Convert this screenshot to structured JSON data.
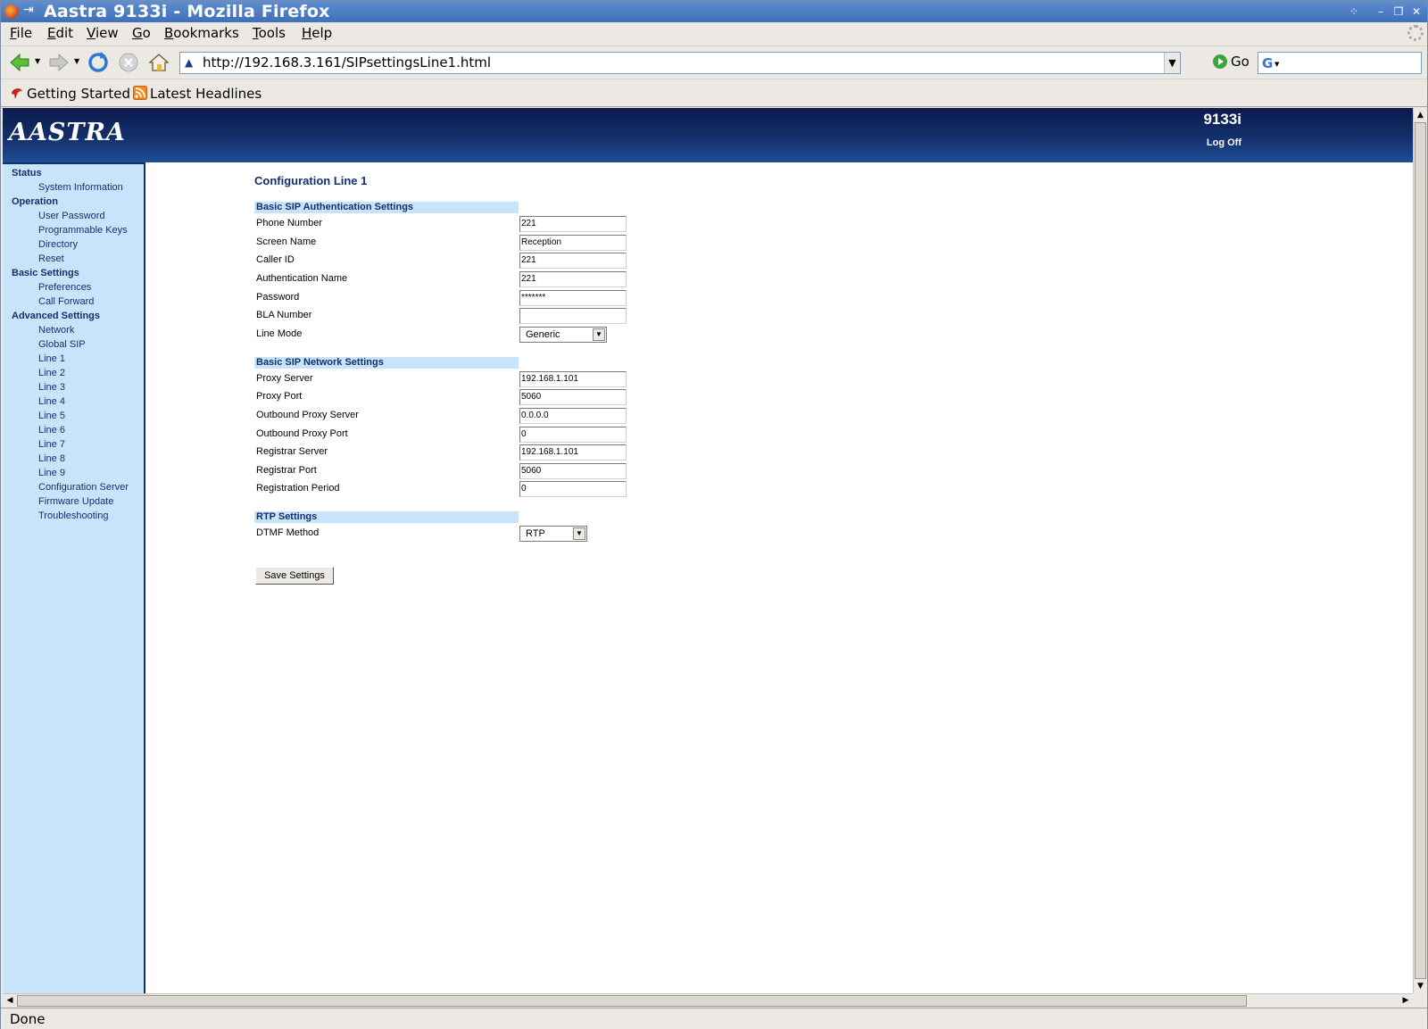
{
  "window": {
    "title": "Aastra 9133i - Mozilla Firefox"
  },
  "menu": [
    "File",
    "Edit",
    "View",
    "Go",
    "Bookmarks",
    "Tools",
    "Help"
  ],
  "navbar": {
    "url": "http://192.168.3.161/SIPsettingsLine1.html",
    "go_label": "Go"
  },
  "bookmarks": [
    "Getting Started",
    "Latest Headlines"
  ],
  "status": "Done",
  "page": {
    "logo": "AASTRA",
    "model": "9133i",
    "logoff": "Log Off",
    "title": "Configuration Line 1",
    "save_label": "Save Settings"
  },
  "sidebar": {
    "groups": [
      {
        "heading": "Status",
        "items": [
          "System Information"
        ]
      },
      {
        "heading": "Operation",
        "items": [
          "User Password",
          "Programmable Keys",
          "Directory",
          "Reset"
        ]
      },
      {
        "heading": "Basic Settings",
        "items": [
          "Preferences",
          "Call Forward"
        ]
      },
      {
        "heading": "Advanced Settings",
        "items": [
          "Network",
          "Global SIP",
          "Line 1",
          "Line 2",
          "Line 3",
          "Line 4",
          "Line 5",
          "Line 6",
          "Line 7",
          "Line 8",
          "Line 9",
          "Configuration Server",
          "Firmware Update",
          "Troubleshooting"
        ]
      }
    ]
  },
  "sections": [
    {
      "heading": "Basic SIP Authentication Settings",
      "fields": [
        {
          "label": "Phone Number",
          "value": "221"
        },
        {
          "label": "Screen Name",
          "value": "Reception"
        },
        {
          "label": "Caller ID",
          "value": "221"
        },
        {
          "label": "Authentication Name",
          "value": "221"
        },
        {
          "label": "Password",
          "value": "*******"
        },
        {
          "label": "BLA Number",
          "value": ""
        },
        {
          "label": "Line Mode",
          "value": "Generic",
          "type": "select"
        }
      ]
    },
    {
      "heading": "Basic SIP Network Settings",
      "fields": [
        {
          "label": "Proxy Server",
          "value": "192.168.1.101"
        },
        {
          "label": "Proxy Port",
          "value": "5060"
        },
        {
          "label": "Outbound Proxy Server",
          "value": "0.0.0.0"
        },
        {
          "label": "Outbound Proxy Port",
          "value": "0"
        },
        {
          "label": "Registrar Server",
          "value": "192.168.1.101"
        },
        {
          "label": "Registrar Port",
          "value": "5060"
        },
        {
          "label": "Registration Period",
          "value": "0"
        }
      ]
    },
    {
      "heading": "RTP Settings",
      "fields": [
        {
          "label": "DTMF Method",
          "value": "RTP",
          "type": "select"
        }
      ]
    }
  ],
  "colors": {
    "banner": "#13306c",
    "sidebar": "#c8e4fb",
    "link": "#14306c"
  }
}
